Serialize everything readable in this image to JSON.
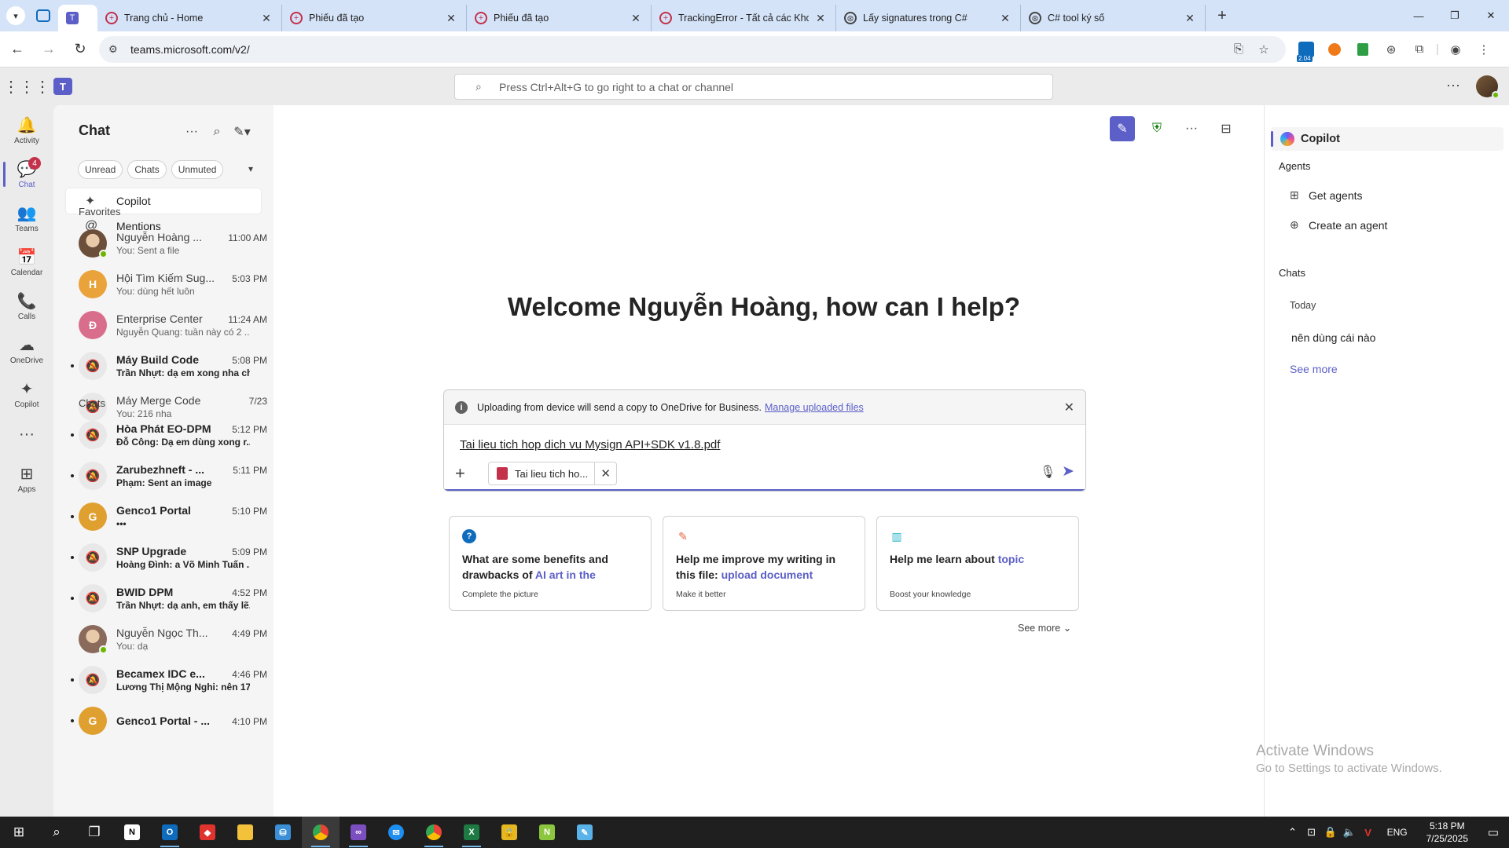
{
  "browser": {
    "tabs": [
      {
        "title": "Trang chủ - Home",
        "favicon": "globe-icon",
        "color": "#c4314b"
      },
      {
        "title": "Phiếu đã tạo",
        "favicon": "globe-icon",
        "color": "#c4314b"
      },
      {
        "title": "Phiếu đã tạo",
        "favicon": "globe-icon",
        "color": "#c4314b"
      },
      {
        "title": "TrackingError - Tất cả các Khoản",
        "favicon": "globe-icon",
        "color": "#c4314b"
      },
      {
        "title": "Lấy signatures trong C#",
        "favicon": "openai-icon",
        "color": "#444444"
      },
      {
        "title": "C# tool ký số",
        "favicon": "openai-icon",
        "color": "#444444"
      }
    ],
    "url": "teams.microsoft.com/v2/",
    "extension_badge": "2.04"
  },
  "teams": {
    "search_placeholder": "Press Ctrl+Alt+G to go right to a chat or channel",
    "rail": [
      {
        "label": "Activity",
        "icon": "bell-icon",
        "glyph": "🔔"
      },
      {
        "label": "Chat",
        "icon": "chat-icon",
        "glyph": "💬",
        "badge": "4",
        "active": true
      },
      {
        "label": "Teams",
        "icon": "teams-icon",
        "glyph": "👥"
      },
      {
        "label": "Calendar",
        "icon": "calendar-icon",
        "glyph": "📅"
      },
      {
        "label": "Calls",
        "icon": "phone-icon",
        "glyph": "📞"
      },
      {
        "label": "OneDrive",
        "icon": "cloud-icon",
        "glyph": "☁"
      },
      {
        "label": "Copilot",
        "icon": "copilot-icon",
        "glyph": "✦"
      },
      {
        "label": "",
        "icon": "more-icon",
        "glyph": "···"
      },
      {
        "label": "Apps",
        "icon": "apps-icon",
        "glyph": "⊞"
      }
    ],
    "chat_pane": {
      "title": "Chat",
      "filters": [
        "Unread",
        "Chats",
        "Unmuted"
      ],
      "pinned": [
        {
          "label": "Copilot",
          "icon": "copilot-icon",
          "glyph": "✦"
        },
        {
          "label": "Mentions",
          "icon": "at-icon",
          "glyph": "@"
        }
      ],
      "favorites_heading": "Favorites",
      "favorites": [
        {
          "name": "Nguyễn Hoàng ...",
          "time": "11:00 AM",
          "preview": "You: Sent a file",
          "avatar": "photo",
          "color": "#6b4f3a",
          "presence": true
        },
        {
          "name": "Hội Tìm Kiếm Sug...",
          "time": "5:03 PM",
          "preview": "You: dùng hết luôn",
          "avatar": "H",
          "color": "#e9a33a"
        },
        {
          "name": "Enterprise Center",
          "time": "11:24 AM",
          "preview": "Nguyễn Quang: tuần này có 2 ...",
          "avatar": "Đ",
          "color": "#d96e8c"
        },
        {
          "name": "Máy Build Code",
          "time": "5:08 PM",
          "preview": "Trần Nhựt: dạ em xong nha chị",
          "avatar": "muted",
          "bold": true,
          "unread": true
        },
        {
          "name": "Máy Merge Code",
          "time": "7/23",
          "preview": "You: 216  nha",
          "avatar": "muted"
        }
      ],
      "chats_heading": "Chats",
      "chats": [
        {
          "name": "Hòa Phát EO-DPM",
          "time": "5:12 PM",
          "preview": "Đỗ Công: Dạ em dùng xong r...",
          "avatar": "muted",
          "bold": true,
          "unread": true
        },
        {
          "name": "Zarubezhneft - ...",
          "time": "5:11 PM",
          "preview": "Phạm: Sent an image",
          "avatar": "muted",
          "bold": true,
          "unread": true
        },
        {
          "name": "Genco1 Portal",
          "time": "5:10 PM",
          "preview": "•••",
          "avatar": "G",
          "color": "#e0a030",
          "bold": true,
          "unread": true
        },
        {
          "name": "SNP Upgrade",
          "time": "5:09 PM",
          "preview": "Hoàng Đình: a Võ Minh Tuấn ...",
          "avatar": "muted",
          "bold": true,
          "unread": true
        },
        {
          "name": "BWID DPM",
          "time": "4:52 PM",
          "preview": "Trần Nhựt: dạ anh, em thấy lẽ...",
          "avatar": "muted",
          "bold": true,
          "unread": true
        },
        {
          "name": "Nguyễn Ngọc Th...",
          "time": "4:49 PM",
          "preview": "You: dạ",
          "avatar": "photo",
          "color": "#8a6a5a",
          "presence": true
        },
        {
          "name": "Becamex IDC e...",
          "time": "4:46 PM",
          "preview": "Lương Thị Mộng Nghi: nên 17...",
          "avatar": "muted",
          "bold": true,
          "unread": true
        },
        {
          "name": "Genco1 Portal - ...",
          "time": "4:10 PM",
          "preview": "",
          "avatar": "G",
          "color": "#e0a030",
          "bold": true,
          "unread": true
        }
      ]
    },
    "main": {
      "welcome": "Welcome Nguyễn Hoàng, how can I help?",
      "notice_text": "Uploading from device will send a copy to OneDrive for Business.",
      "notice_link": "Manage uploaded files",
      "draft_text": "Tai lieu tich hop dich vu Mysign API+SDK v1.8.pdf",
      "attachment_label": "Tai lieu tich ho...",
      "cards": [
        {
          "icon": "question-icon",
          "glyph": "?",
          "color": "#0f6cbd",
          "text_plain": "What are some benefits and drawbacks of ",
          "text_accent": "AI art in the creativ...",
          "sub": "Complete the picture"
        },
        {
          "icon": "pencil-icon",
          "glyph": "✎",
          "color": "#e8613c",
          "text_plain": "Help me improve my writing in this file: ",
          "text_accent": "upload document",
          "sub": "Make it better"
        },
        {
          "icon": "books-icon",
          "glyph": "▥",
          "color": "#2bb4c8",
          "text_plain": "Help me learn about ",
          "text_accent": "topic",
          "sub": "Boost your knowledge"
        }
      ],
      "see_more": "See more"
    },
    "right_pane": {
      "copilot": "Copilot",
      "agents_heading": "Agents",
      "get_agents": "Get agents",
      "create_agent": "Create an agent",
      "chats_heading": "Chats",
      "today": "Today",
      "recent_chat": "nên dùng cái nào",
      "see_more": "See more"
    }
  },
  "os": {
    "watermark_title": "Activate Windows",
    "watermark_sub": "Go to Settings to activate Windows.",
    "lang": "ENG",
    "time": "5:18 PM",
    "date": "7/25/2025"
  }
}
